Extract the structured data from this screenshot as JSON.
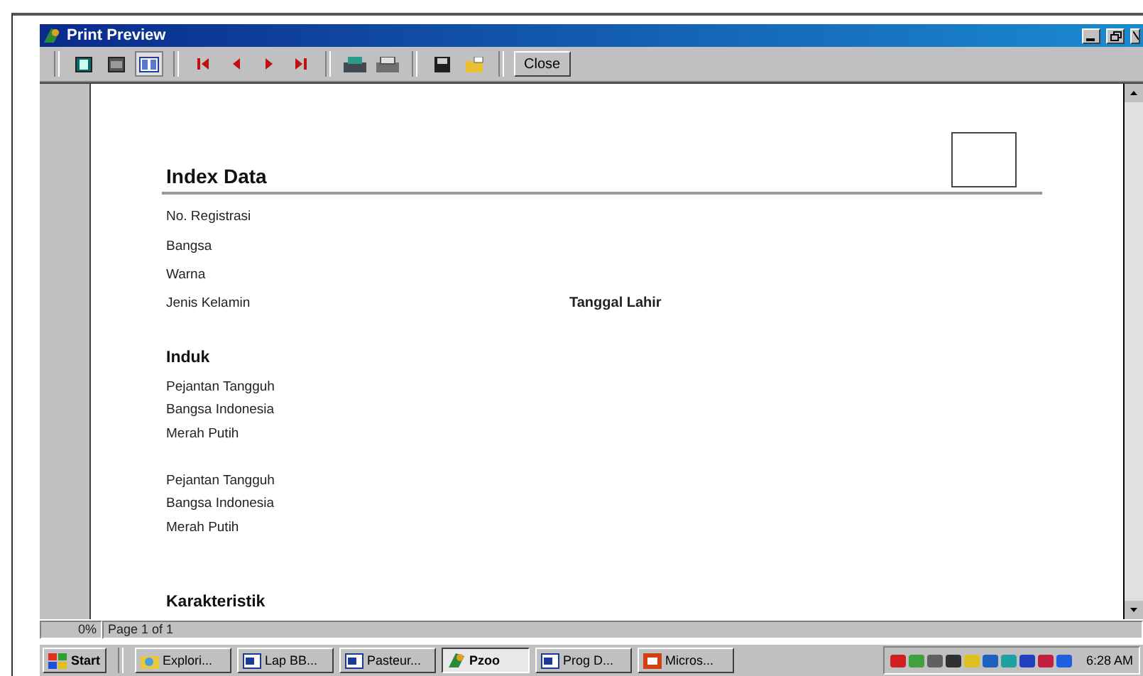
{
  "window": {
    "title": "Print Preview"
  },
  "toolbar": {
    "view_buttons": [
      {
        "kind": "one-page",
        "selected": false
      },
      {
        "kind": "two-page",
        "selected": false
      },
      {
        "kind": "zoom",
        "selected": true
      }
    ],
    "nav_buttons": [
      {
        "kind": "first"
      },
      {
        "kind": "prev"
      },
      {
        "kind": "next"
      },
      {
        "kind": "last"
      }
    ],
    "close_label": "Close"
  },
  "report": {
    "title": "Index Data",
    "fields": [
      {
        "label": "No. Registrasi"
      },
      {
        "label": "Bangsa"
      },
      {
        "label": "Warna"
      },
      {
        "label": "Jenis Kelamin",
        "extra": "Tanggal Lahir"
      }
    ],
    "sections": [
      {
        "heading": "Induk",
        "groups": [
          [
            "Pejantan Tangguh",
            "Bangsa Indonesia",
            "Merah Putih"
          ],
          [
            "Pejantan Tangguh",
            "Bangsa Indonesia",
            "Merah Putih"
          ]
        ]
      },
      {
        "heading": "Karakteristik"
      }
    ]
  },
  "status_bar": {
    "zoom": "0%",
    "page": "Page 1 of 1"
  },
  "taskbar": {
    "start": "Start",
    "tasks": [
      {
        "label": "Explori...",
        "kind": "folder",
        "selected": false
      },
      {
        "label": "Lap BB...",
        "kind": "word",
        "selected": false
      },
      {
        "label": "Pasteur...",
        "kind": "word",
        "selected": false
      },
      {
        "label": "Pzoo",
        "kind": "app",
        "selected": true
      },
      {
        "label": "Prog D...",
        "kind": "word",
        "selected": false
      },
      {
        "label": "Micros...",
        "kind": "ppt",
        "selected": false
      }
    ],
    "clock": "6:28 AM"
  }
}
